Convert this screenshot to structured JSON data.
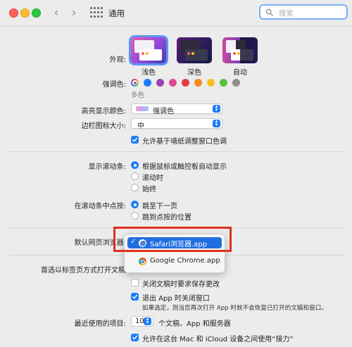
{
  "window": {
    "title": "通用"
  },
  "search": {
    "placeholder": "搜索"
  },
  "appearance": {
    "label": "外观:",
    "options": [
      {
        "name": "浅色",
        "selected": true
      },
      {
        "name": "深色",
        "selected": false
      },
      {
        "name": "自动",
        "selected": false
      }
    ]
  },
  "accent": {
    "label": "强调色:",
    "caption": "多色",
    "colors": [
      "#c26ad8",
      "#1f7cf6",
      "#9b3fb5",
      "#e0488e",
      "#e23c3c",
      "#f28a1e",
      "#f5c21d",
      "#5cbf35",
      "#8e8e8e"
    ]
  },
  "highlight": {
    "label": "高亮显示颜色:",
    "value": "强调色"
  },
  "sidebar_icon": {
    "label": "边栏图标大小:",
    "value": "中"
  },
  "wallpaper_tint": {
    "label": "允许基于墙纸调整窗口色调",
    "checked": true
  },
  "scrollbars": {
    "label": "显示滚动条:",
    "options": [
      {
        "label": "根据鼠标或触控板自动显示",
        "selected": true
      },
      {
        "label": "滚动时",
        "selected": false
      },
      {
        "label": "始终",
        "selected": false
      }
    ]
  },
  "scroll_click": {
    "label": "在滚动条中点按:",
    "options": [
      {
        "label": "跳至下一页",
        "selected": true
      },
      {
        "label": "跳到点按的位置",
        "selected": false
      }
    ]
  },
  "browser": {
    "label": "默认网页浏览器:",
    "menu": [
      {
        "label": "Safari浏览器.app",
        "selected": true,
        "check": "✓"
      },
      {
        "label": "Google Chrome.app",
        "selected": false
      }
    ]
  },
  "tabs_pref": {
    "label": "首选以标签页方式打开文稿"
  },
  "ask_save": {
    "label": "关闭文稿时要求保存更改",
    "checked": false
  },
  "close_windows": {
    "label": "退出 App 时关闭窗口",
    "checked": true,
    "note": "如果选定，则当您再次打开 App 时就不会恢复已打开的文稿和窗口。"
  },
  "recent": {
    "label": "最近使用的项目:",
    "value": "10",
    "suffix": "个文稿、App 和服务器"
  },
  "handoff": {
    "label": "允许在这台 Mac 和 iCloud 设备之间使用“接力”",
    "checked": true
  }
}
